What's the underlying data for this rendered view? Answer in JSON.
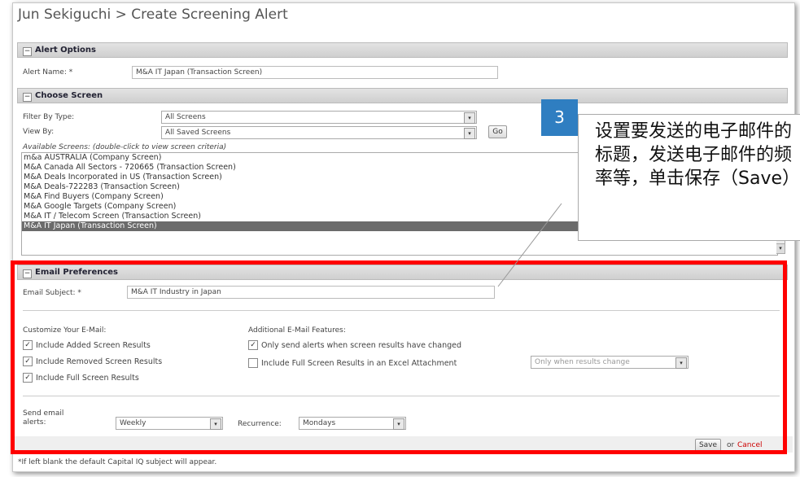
{
  "page": {
    "title": "Jun Sekiguchi > Create Screening Alert"
  },
  "alert_options": {
    "header": "Alert Options",
    "toggle_glyph": "−",
    "name_label": "Alert Name: *",
    "name_value": "M&A IT Japan (Transaction Screen)"
  },
  "choose_screen": {
    "header": "Choose Screen",
    "toggle_glyph": "−",
    "filter_label": "Filter By Type:",
    "filter_value": "All Screens",
    "view_label": "View By:",
    "view_value": "All Saved Screens",
    "go_label": "Go",
    "available_label": "Available Screens: (double-click to view screen criteria)",
    "screens": [
      "m&a AUSTRALIA (Company Screen)",
      "M&A Canada All Sectors - 720665 (Transaction Screen)",
      "M&A Deals Incorporated in US (Transaction Screen)",
      "M&A Deals-722283 (Transaction Screen)",
      "M&A Find Buyers (Company Screen)",
      "M&A Google Targets (Company Screen)",
      "M&A IT / Telecom Screen (Transaction Screen)",
      "M&A IT Japan (Transaction Screen)"
    ],
    "selected_index": 7
  },
  "email_prefs": {
    "header": "Email Preferences",
    "toggle_glyph": "−",
    "subject_label": "Email Subject: *",
    "subject_value": "M&A IT Industry in Japan",
    "customize_heading": "Customize Your E-Mail:",
    "customize_options": [
      {
        "label": "Include Added Screen Results",
        "checked": true
      },
      {
        "label": "Include Removed Screen Results",
        "checked": true
      },
      {
        "label": "Include Full Screen Results",
        "checked": true
      }
    ],
    "additional_heading": "Additional E-Mail Features:",
    "only_send_label": "Only send alerts when screen results have changed",
    "only_send_checked": true,
    "excel_label": "Include Full Screen Results in an Excel Attachment",
    "excel_checked": false,
    "excel_select_value": "Only when results change",
    "send_label": "Send email alerts:",
    "frequency_value": "Weekly",
    "recurrence_label": "Recurrence:",
    "recurrence_value": "Mondays",
    "save_label": "Save",
    "or_text": "or",
    "cancel_label": "Cancel"
  },
  "footer_note": "*If left blank the default Capital IQ subject will appear.",
  "callout": {
    "number": "3",
    "text": "设置要发送的电子邮件的标题，发送电子邮件的频率等，单击保存（Save）"
  },
  "colors": {
    "highlight_red": "#ff0000",
    "callout_blue": "#2f7ec1",
    "selected_row": "#6b6b6b"
  },
  "icons": {
    "check": "✓",
    "dropdown": "▾"
  }
}
